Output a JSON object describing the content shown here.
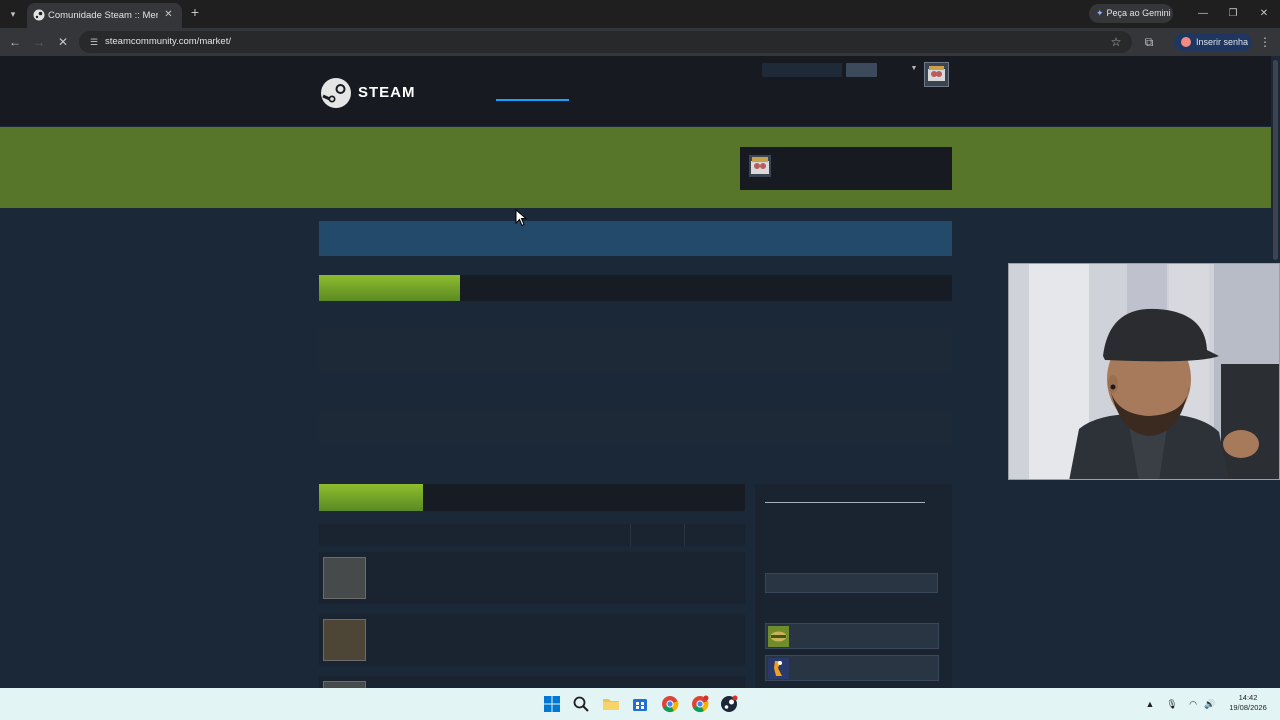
{
  "browser": {
    "tab_title": "Comunidade Steam :: Mercado",
    "url": "steamcommunity.com/market/",
    "gemini_label": "Peça ao Gemini",
    "password_label": "Inserir senha"
  },
  "steam": {
    "logo_text": "STEAM"
  },
  "system": {
    "time": "14:42",
    "date": "19/08/2026"
  },
  "colors": {
    "header_bg": "#171a21",
    "page_bg": "#1b2838",
    "banner_green": "#57762a",
    "search_blue": "#23496b",
    "tab_active_green": "#8ebd2e",
    "nav_underline": "#1a9fff"
  },
  "icons": [
    "tab-list-icon",
    "steam-favicon",
    "close-icon",
    "plus-icon",
    "gemini-icon",
    "minimize-icon",
    "restore-icon",
    "back-icon",
    "forward-icon",
    "stop-icon",
    "site-info-icon",
    "star-icon",
    "extensions-icon",
    "key-icon",
    "menu-icon",
    "steam-logo-icon",
    "chevron-down-icon",
    "windows-start-icon",
    "search-icon",
    "file-explorer-icon",
    "store-icon",
    "chrome-icon",
    "steam-icon",
    "chevron-up-icon",
    "microphone-icon",
    "wifi-icon",
    "volume-icon"
  ]
}
